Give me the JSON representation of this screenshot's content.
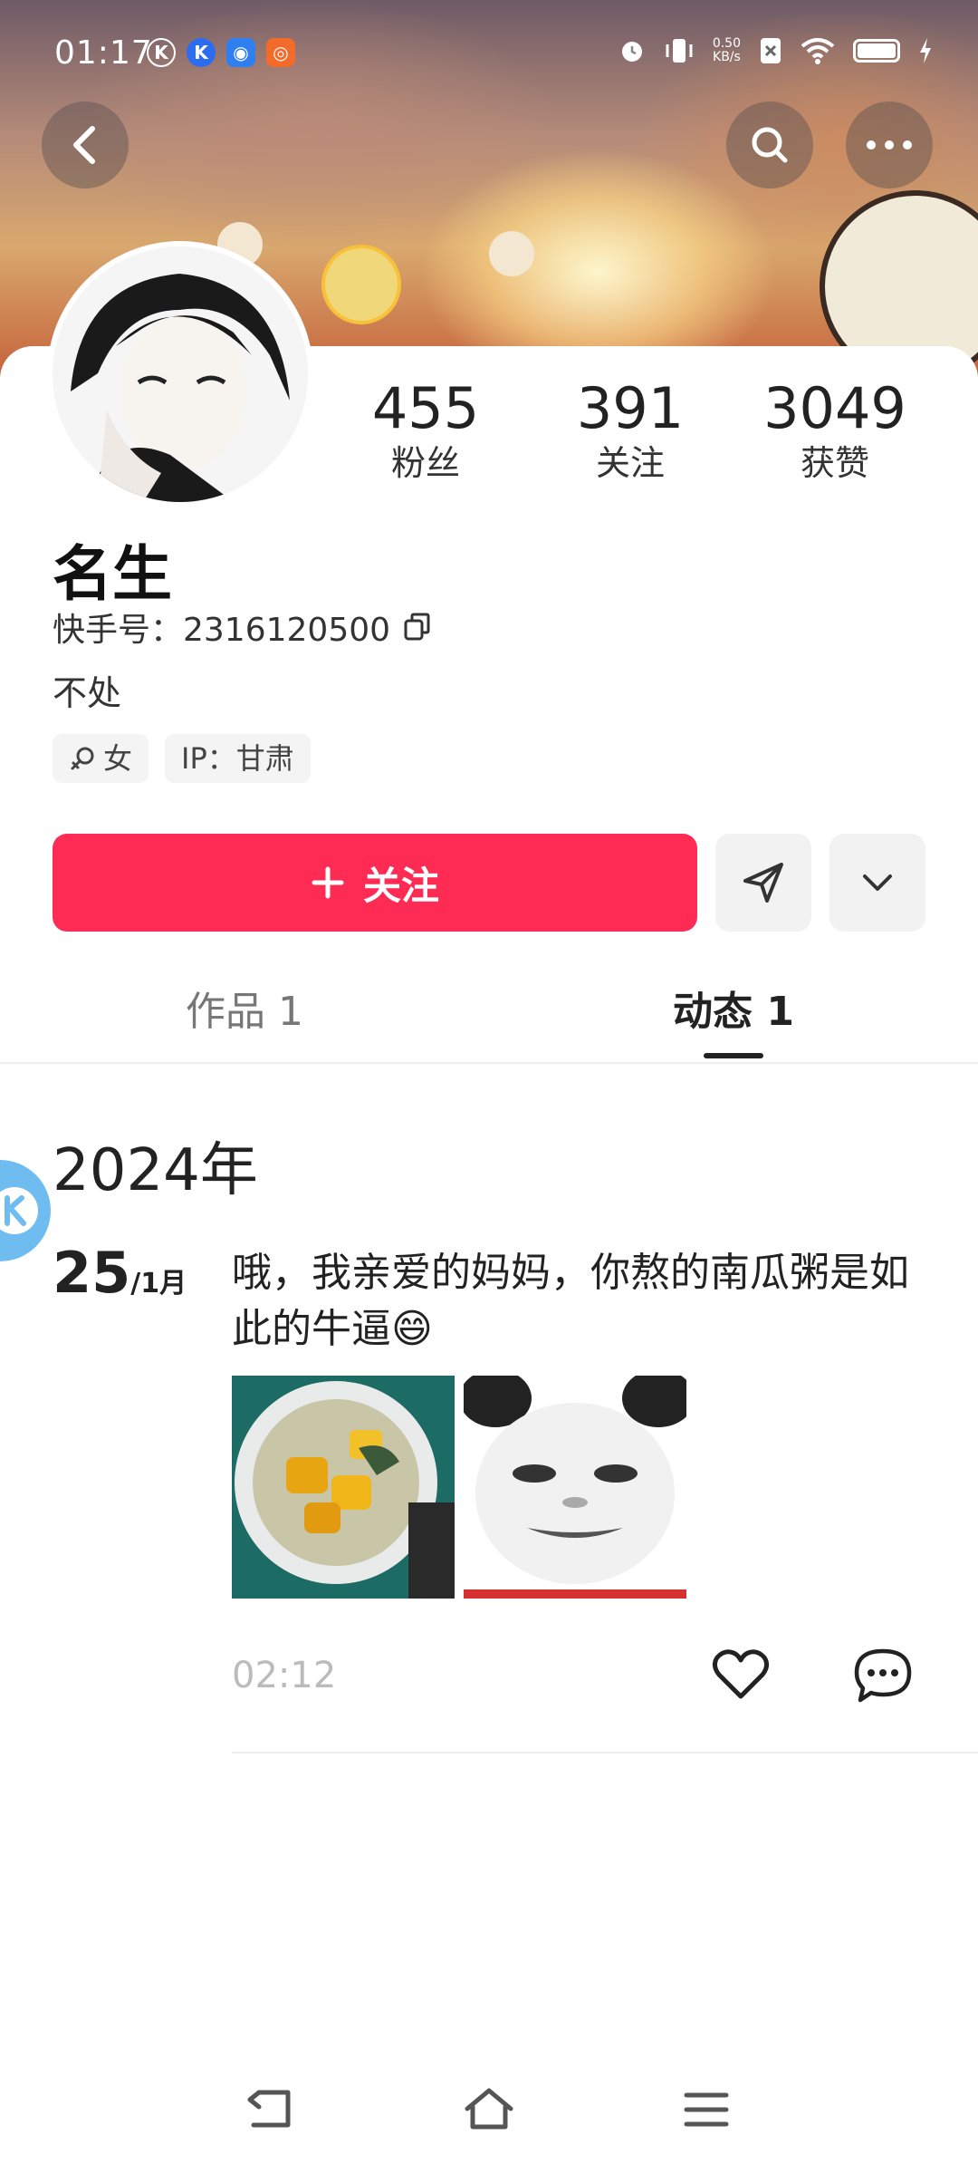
{
  "status_bar": {
    "time": "01:17",
    "net_speed_value": "0.50",
    "net_speed_unit": "KB/s"
  },
  "profile": {
    "stats": [
      {
        "value": "455",
        "label": "粉丝"
      },
      {
        "value": "391",
        "label": "关注"
      },
      {
        "value": "3049",
        "label": "获赞"
      }
    ],
    "name": "名生",
    "kuaishou_id": "快手号：2316120500",
    "bio": "不处",
    "tags": {
      "gender": "女",
      "ip": "IP：甘肃"
    }
  },
  "actions": {
    "follow_label": "关注"
  },
  "tabs": [
    {
      "label": "作品 1",
      "active": false
    },
    {
      "label": "动态 1",
      "active": true
    }
  ],
  "feed": {
    "year": "2024年",
    "posts": [
      {
        "day": "25",
        "month": "/1月",
        "text": "哦，我亲爱的妈妈，你熬的南瓜粥是如此的牛逼😄",
        "time": "02:12"
      }
    ]
  },
  "colors": {
    "accent": "#fe2c55"
  }
}
